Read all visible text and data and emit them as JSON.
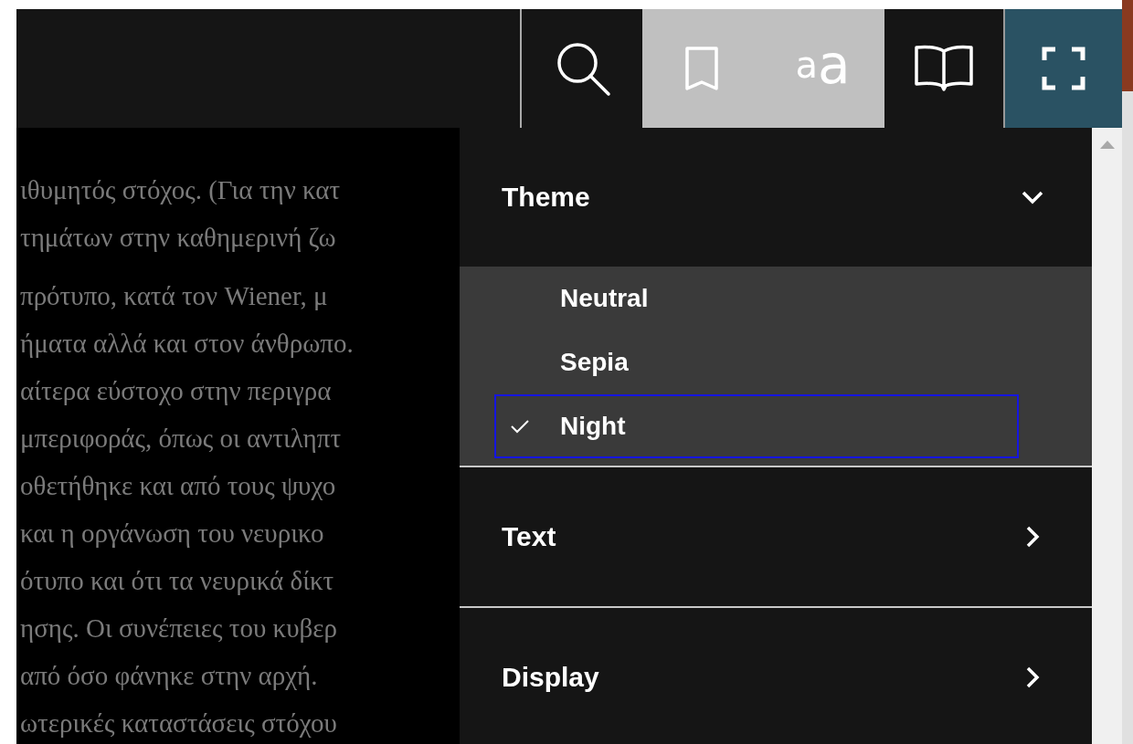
{
  "toolbar": {
    "buttons": [
      {
        "kind": "search",
        "selected": false,
        "focused": false
      },
      {
        "kind": "bookmark",
        "selected": true,
        "focused": false
      },
      {
        "kind": "font",
        "selected": true,
        "focused": false,
        "glyphs": [
          "a",
          "a"
        ]
      },
      {
        "kind": "contents",
        "selected": false,
        "focused": false
      },
      {
        "kind": "fullscreen",
        "selected": false,
        "focused": true
      }
    ]
  },
  "content": {
    "paragraphs": [
      [
        "ιθυμητός στόχος. (Για την κατ",
        "τημάτων στην καθημερινή ζω"
      ],
      [
        "πρότυπο, κατά τον Wiener, μ",
        "ήματα αλλά και στον άνθρωπο.",
        "αίτερα εύστοχο στην περιγρα",
        "μπεριφοράς, όπως οι αντιληπτ",
        "οθετήθηκε και από τους ψυχο",
        "και η οργάνωση του νευρικο",
        "ότυπο και ότι τα νευρικά δίκτ",
        "ησης. Οι συνέπειες του κυβερ",
        "από όσο φάνηκε στην αρχή.",
        "ωτερικές καταστάσεις στόχου"
      ]
    ]
  },
  "settings_menu": {
    "sections": [
      {
        "title": "Theme",
        "expanded": true,
        "options": [
          {
            "label": "Neutral",
            "selected": false,
            "focused": false
          },
          {
            "label": "Sepia",
            "selected": false,
            "focused": false
          },
          {
            "label": "Night",
            "selected": true,
            "focused": true
          }
        ]
      },
      {
        "title": "Text",
        "expanded": false
      },
      {
        "title": "Display",
        "expanded": false
      }
    ]
  }
}
